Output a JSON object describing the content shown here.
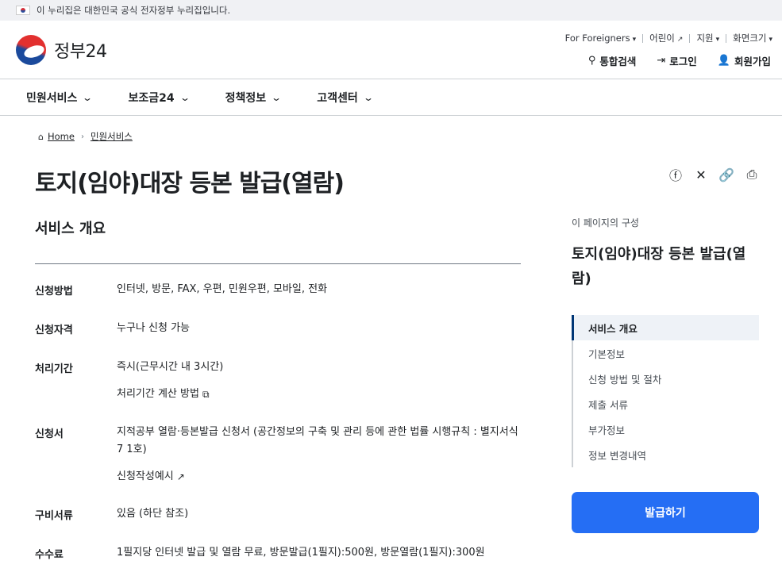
{
  "banner": {
    "text": "이 누리집은 대한민국 공식 전자정부 누리집입니다."
  },
  "logo": {
    "name": "정부24"
  },
  "utility": {
    "foreigners": "For Foreigners",
    "kids": "어린이",
    "support": "지원",
    "zoom": "화면크기"
  },
  "actions": {
    "search": "통합검색",
    "login": "로그인",
    "signup": "회원가입"
  },
  "gnb": [
    "민원서비스",
    "보조금24",
    "정책정보",
    "고객센터"
  ],
  "breadcrumb": {
    "home": "Home",
    "current": "민원서비스"
  },
  "page": {
    "title": "토지(임야)대장 등본 발급(열람)",
    "section": "서비스 개요"
  },
  "info": [
    {
      "label": "신청방법",
      "value": "인터넷, 방문, FAX, 우편, 민원우편, 모바일, 전화"
    },
    {
      "label": "신청자격",
      "value": "누구나 신청 가능"
    },
    {
      "label": "처리기간",
      "value": "즉시(근무시간 내 3시간)",
      "sub": "처리기간 계산 방법"
    },
    {
      "label": "신청서",
      "value": "지적공부 열람·등본발급 신청서 (공간정보의 구축 및 관리 등에 관한 법률 시행규칙 : 별지서식 7 1호)",
      "sub": "신청작성예시"
    },
    {
      "label": "구비서류",
      "value": "있음 (하단 참조)"
    },
    {
      "label": "수수료",
      "value": "1필지당 인터넷 발급 및 열람 무료, 방문발급(1필지):500원, 방문열람(1필지):300원"
    }
  ],
  "toc": {
    "caption": "이 페이지의 구성",
    "title": "토지(임야)대장 등본 발급(열람)",
    "items": [
      "서비스 개요",
      "기본정보",
      "신청 방법 및 절차",
      "제출 서류",
      "부가정보",
      "정보 변경내역"
    ]
  },
  "issue_button": "발급하기"
}
